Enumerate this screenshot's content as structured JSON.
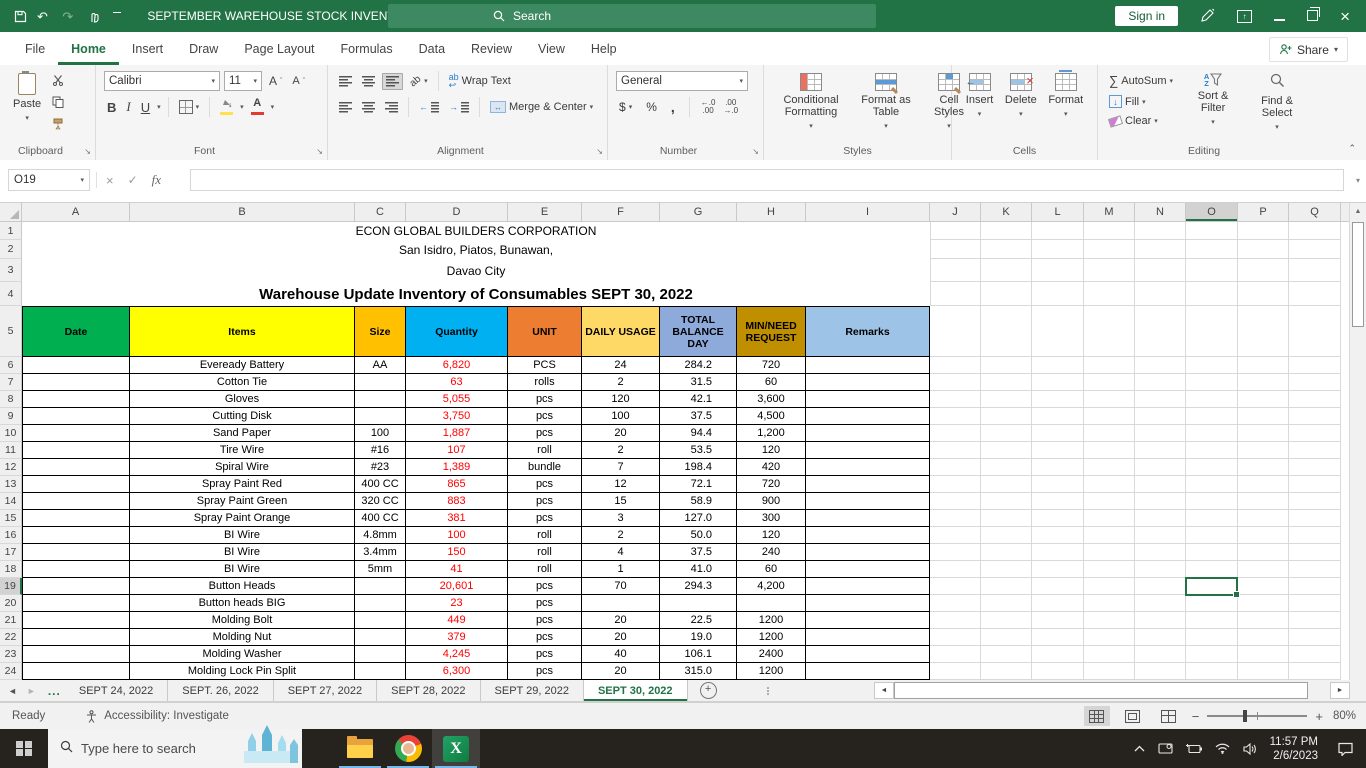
{
  "theme": {
    "excel_green": "#217346",
    "quantity_text_color": "#FF0000",
    "taskbar_underline": "#76B9ED"
  },
  "title_bar": {
    "title": "SEPTEMBER WAREHOUSE STOCK INVENTORY - Excel",
    "search_placeholder": "Search",
    "sign_in_label": "Sign in"
  },
  "menu": {
    "tabs": [
      "File",
      "Home",
      "Insert",
      "Draw",
      "Page Layout",
      "Formulas",
      "Data",
      "Review",
      "View",
      "Help"
    ],
    "active_tab": "Home",
    "share_label": "Share"
  },
  "ribbon": {
    "clipboard": {
      "group_label": "Clipboard",
      "paste_label": "Paste"
    },
    "font": {
      "group_label": "Font",
      "family": "Calibri",
      "size": "11",
      "bold": "B",
      "italic": "I",
      "underline": "U"
    },
    "alignment": {
      "group_label": "Alignment",
      "wrap_text_label": "Wrap Text",
      "merge_center_label": "Merge & Center"
    },
    "number": {
      "group_label": "Number",
      "format": "General",
      "currency": "$",
      "percent": "%",
      "comma": ","
    },
    "styles": {
      "group_label": "Styles",
      "conditional_label": "Conditional Formatting",
      "format_table_label": "Format as Table",
      "cell_styles_label": "Cell Styles"
    },
    "cells": {
      "group_label": "Cells",
      "insert_label": "Insert",
      "delete_label": "Delete",
      "format_label": "Format"
    },
    "editing": {
      "group_label": "Editing",
      "autosum_label": "AutoSum",
      "fill_label": "Fill",
      "clear_label": "Clear",
      "sort_label": "Sort & Filter",
      "find_label": "Find & Select"
    }
  },
  "formula_bar": {
    "name_box": "O19",
    "fx_label": "fx",
    "formula_value": ""
  },
  "grid": {
    "columns": [
      "A",
      "B",
      "C",
      "D",
      "E",
      "F",
      "G",
      "H",
      "I",
      "J",
      "K",
      "L",
      "M",
      "N",
      "O",
      "P",
      "Q"
    ],
    "active_column": "O",
    "row_numbers": [
      1,
      2,
      3,
      4,
      5,
      6,
      7,
      8,
      9,
      10,
      11,
      12,
      13,
      14,
      15,
      16,
      17,
      18,
      19,
      20,
      21,
      22,
      23,
      24
    ],
    "active_row": 19,
    "title_lines": [
      "ECON GLOBAL BUILDERS CORPORATION",
      "San Isidro, Piatos, Bunawan,",
      "Davao City",
      "Warehouse Update Inventory of Consumables SEPT 30, 2022"
    ],
    "headers": [
      {
        "label": "Date",
        "fill": "#00B050"
      },
      {
        "label": "Items",
        "fill": "#FFFF00"
      },
      {
        "label": "Size",
        "fill": "#FFC000"
      },
      {
        "label": "Quantity",
        "fill": "#00B0F0"
      },
      {
        "label": "UNIT",
        "fill": "#ED7D31"
      },
      {
        "label": "DAILY USAGE",
        "fill": "#FFD966"
      },
      {
        "label": "TOTAL BALANCE DAY",
        "fill": "#8EAADB"
      },
      {
        "label": "MIN/NEED REQUEST",
        "fill": "#BF8F00"
      },
      {
        "label": "Remarks",
        "fill": "#9DC3E6"
      }
    ],
    "rows": [
      [
        "",
        "Eveready Battery",
        "AA",
        "6,820",
        "PCS",
        "24",
        "284.2",
        "720",
        ""
      ],
      [
        "",
        "Cotton Tie",
        "",
        "63",
        "rolls",
        "2",
        "31.5",
        "60",
        ""
      ],
      [
        "",
        "Gloves",
        "",
        "5,055",
        "pcs",
        "120",
        "42.1",
        "3,600",
        ""
      ],
      [
        "",
        "Cutting Disk",
        "",
        "3,750",
        "pcs",
        "100",
        "37.5",
        "4,500",
        ""
      ],
      [
        "",
        "Sand Paper",
        "100",
        "1,887",
        "pcs",
        "20",
        "94.4",
        "1,200",
        ""
      ],
      [
        "",
        "Tire Wire",
        "#16",
        "107",
        "roll",
        "2",
        "53.5",
        "120",
        ""
      ],
      [
        "",
        "Spiral Wire",
        "#23",
        "1,389",
        "bundle",
        "7",
        "198.4",
        "420",
        ""
      ],
      [
        "",
        "Spray Paint Red",
        "400 CC",
        "865",
        "pcs",
        "12",
        "72.1",
        "720",
        ""
      ],
      [
        "",
        "Spray Paint Green",
        "320 CC",
        "883",
        "pcs",
        "15",
        "58.9",
        "900",
        ""
      ],
      [
        "",
        "Spray Paint Orange",
        "400 CC",
        "381",
        "pcs",
        "3",
        "127.0",
        "300",
        ""
      ],
      [
        "",
        "BI Wire",
        "4.8mm",
        "100",
        "roll",
        "2",
        "50.0",
        "120",
        ""
      ],
      [
        "",
        "BI Wire",
        "3.4mm",
        "150",
        "roll",
        "4",
        "37.5",
        "240",
        ""
      ],
      [
        "",
        "BI Wire",
        "5mm",
        "41",
        "roll",
        "1",
        "41.0",
        "60",
        ""
      ],
      [
        "",
        "Button Heads",
        "",
        "20,601",
        "pcs",
        "70",
        "294.3",
        "4,200",
        ""
      ],
      [
        "",
        "Button heads BIG",
        "",
        "23",
        "pcs",
        "",
        "",
        "",
        ""
      ],
      [
        "",
        "Molding Bolt",
        "",
        "449",
        "pcs",
        "20",
        "22.5",
        "1200",
        ""
      ],
      [
        "",
        "Molding Nut",
        "",
        "379",
        "pcs",
        "20",
        "19.0",
        "1200",
        ""
      ],
      [
        "",
        "Molding Washer",
        "",
        "4,245",
        "pcs",
        "40",
        "106.1",
        "2400",
        ""
      ],
      [
        "",
        "Molding Lock Pin Split",
        "",
        "6,300",
        "pcs",
        "20",
        "315.0",
        "1200",
        ""
      ]
    ]
  },
  "sheet_tabs": {
    "overflow_indicator": "...",
    "tabs": [
      "SEPT 24, 2022",
      "SEPT. 26, 2022",
      "SEPT 27, 2022",
      "SEPT 28, 2022",
      "SEPT 29, 2022",
      "SEPT 30, 2022"
    ],
    "active_tab": "SEPT 30, 2022"
  },
  "status_bar": {
    "mode": "Ready",
    "accessibility": "Accessibility: Investigate",
    "zoom": "80%"
  },
  "taskbar": {
    "search_placeholder": "Type here to search",
    "time": "11:57 PM",
    "date": "2/6/2023"
  }
}
